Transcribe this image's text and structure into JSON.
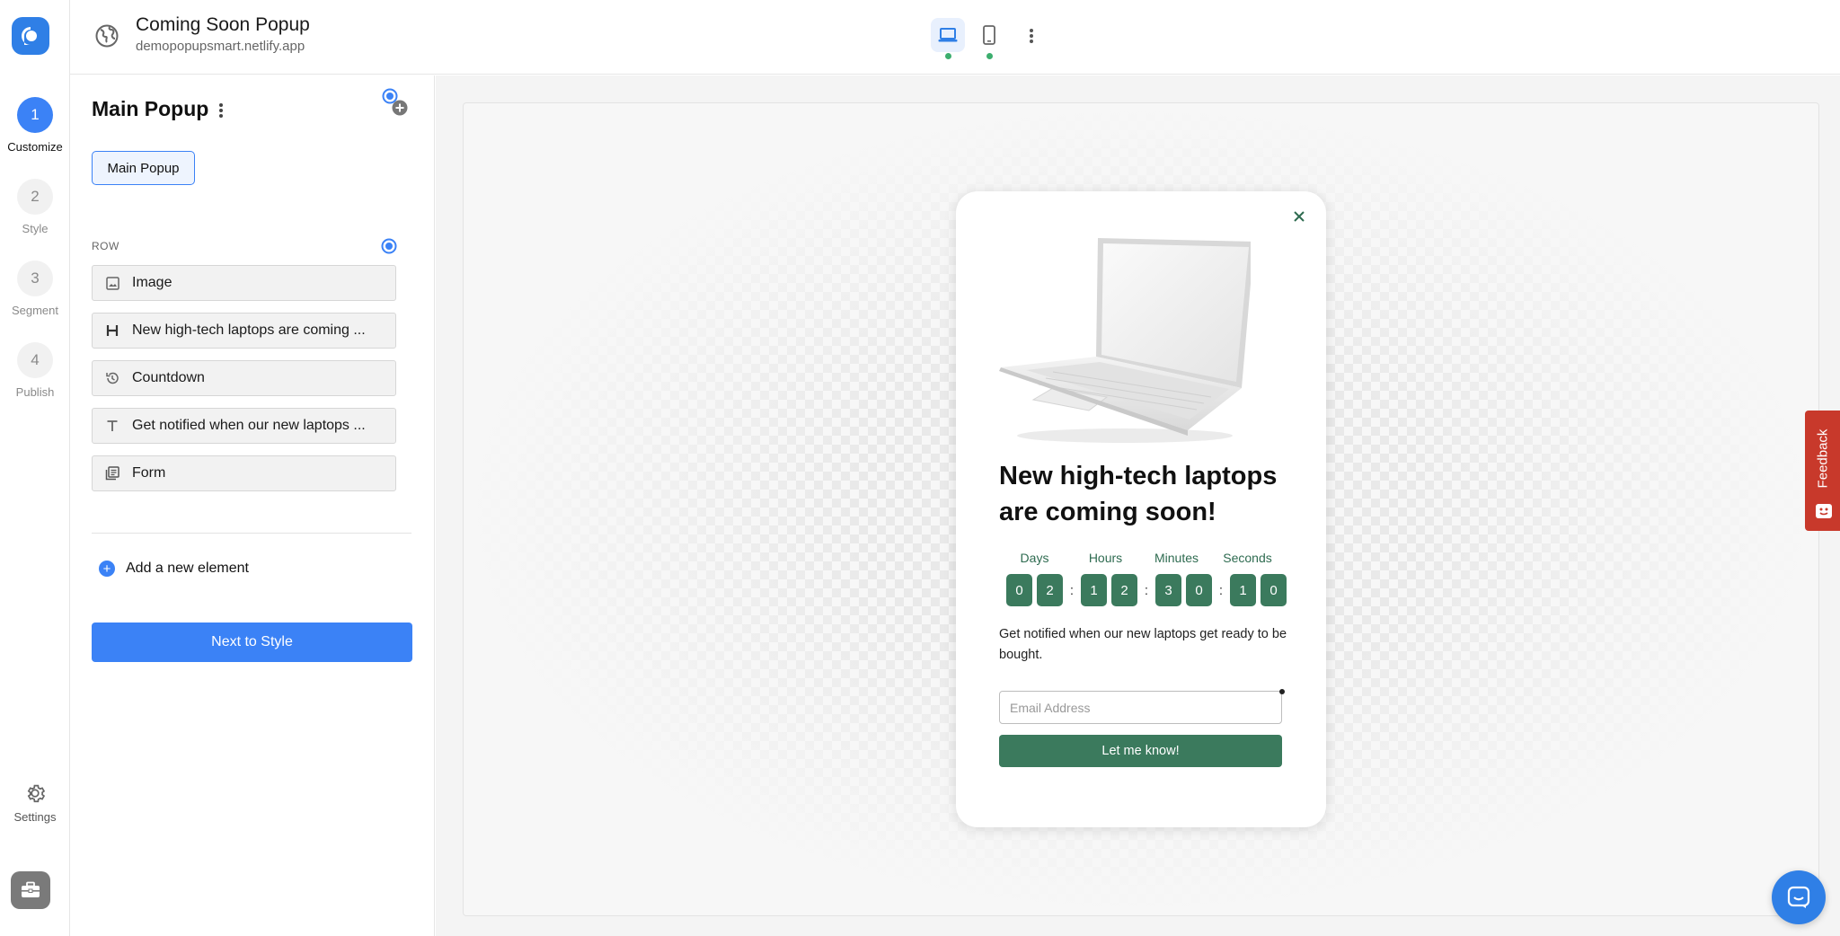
{
  "rail": {
    "steps": [
      {
        "num": "1",
        "label": "Customize"
      },
      {
        "num": "2",
        "label": "Style"
      },
      {
        "num": "3",
        "label": "Segment"
      },
      {
        "num": "4",
        "label": "Publish"
      }
    ],
    "settings_label": "Settings"
  },
  "topbar": {
    "title": "Coming Soon Popup",
    "url": "demopopupsmart.netlify.app"
  },
  "panel": {
    "title": "Main Popup",
    "chip": "Main Popup",
    "row_label": "ROW",
    "elements": [
      {
        "icon": "image-icon",
        "label": "Image"
      },
      {
        "icon": "heading-icon",
        "label": "New high-tech laptops are coming ..."
      },
      {
        "icon": "history-icon",
        "label": "Countdown"
      },
      {
        "icon": "text-icon",
        "label": "Get notified when our new laptops ..."
      },
      {
        "icon": "form-icon",
        "label": "Form"
      }
    ],
    "add_label": "Add a new element",
    "next_label": "Next to Style"
  },
  "popup": {
    "headline": "New high-tech laptops are coming soon!",
    "countdown": {
      "labels": [
        "Days",
        "Hours",
        "Minutes",
        "Seconds"
      ],
      "digits": [
        "0",
        "2",
        "1",
        "2",
        "3",
        "0",
        "1",
        "0"
      ]
    },
    "subtext": "Get notified when our new laptops get ready to be bought.",
    "email_placeholder": "Email Address",
    "cta_label": "Let me know!"
  },
  "feedback_label": "Feedback",
  "colors": {
    "primary": "#3b82f6",
    "popup_accent": "#3b7a5d",
    "feedback": "#c8392b"
  }
}
